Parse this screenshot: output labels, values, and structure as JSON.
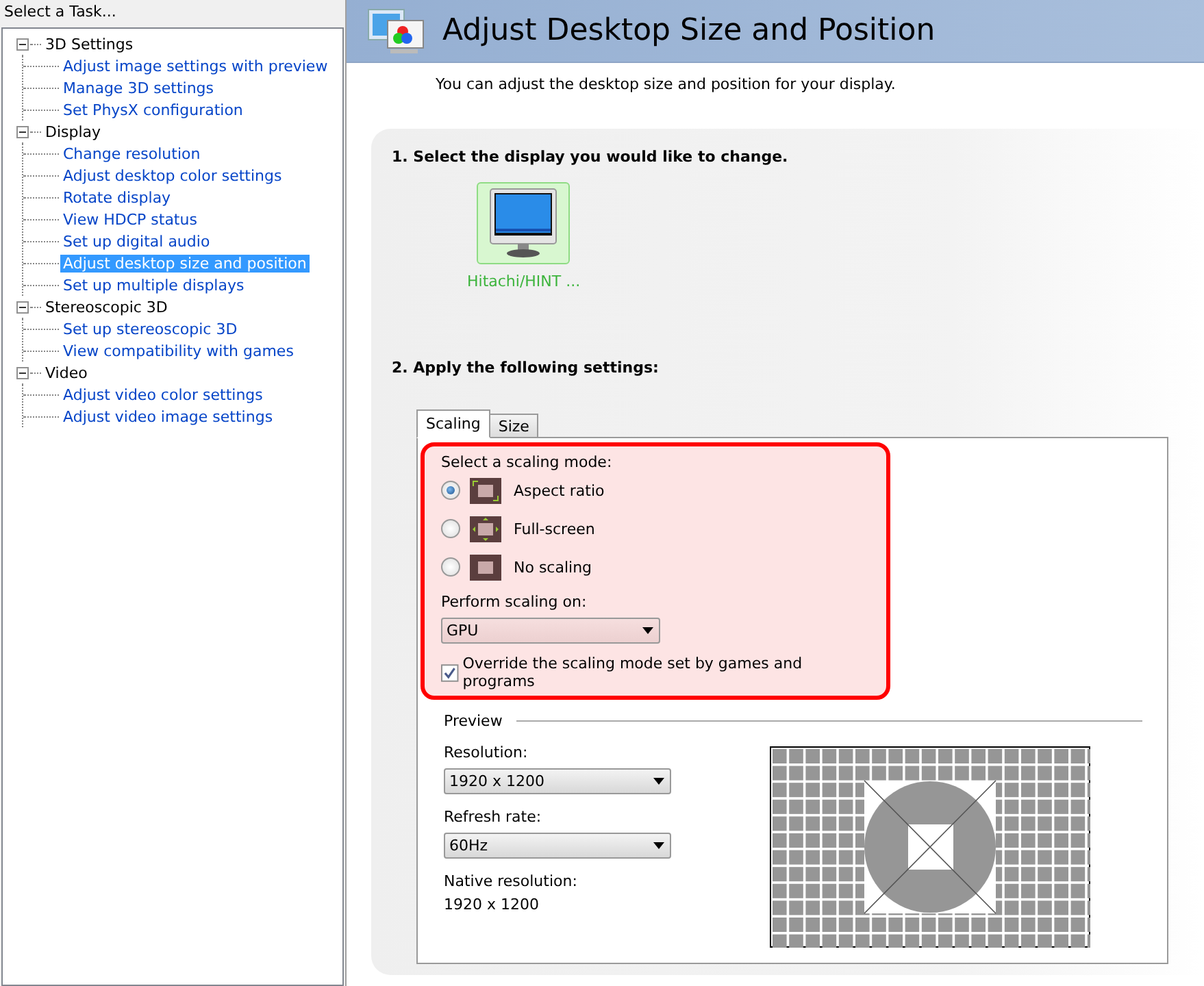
{
  "task_panel": {
    "title": "Select a Task...",
    "tree": [
      {
        "label": "3D Settings",
        "expanded": true,
        "children": [
          {
            "label": "Adjust image settings with preview",
            "selected": false
          },
          {
            "label": "Manage 3D settings",
            "selected": false
          },
          {
            "label": "Set PhysX configuration",
            "selected": false
          }
        ]
      },
      {
        "label": "Display",
        "expanded": true,
        "children": [
          {
            "label": "Change resolution",
            "selected": false
          },
          {
            "label": "Adjust desktop color settings",
            "selected": false
          },
          {
            "label": "Rotate display",
            "selected": false
          },
          {
            "label": "View HDCP status",
            "selected": false
          },
          {
            "label": "Set up digital audio",
            "selected": false
          },
          {
            "label": "Adjust desktop size and position",
            "selected": true
          },
          {
            "label": "Set up multiple displays",
            "selected": false
          }
        ]
      },
      {
        "label": "Stereoscopic 3D",
        "expanded": true,
        "children": [
          {
            "label": "Set up stereoscopic 3D",
            "selected": false
          },
          {
            "label": "View compatibility with games",
            "selected": false
          }
        ]
      },
      {
        "label": "Video",
        "expanded": true,
        "children": [
          {
            "label": "Adjust video color settings",
            "selected": false
          },
          {
            "label": "Adjust video image settings",
            "selected": false
          }
        ]
      }
    ]
  },
  "page": {
    "title": "Adjust Desktop Size and Position",
    "description": "You can adjust the desktop size and position for your display."
  },
  "step1": {
    "heading": "1. Select the display you would like to change.",
    "displays": [
      {
        "label": "Hitachi/HINT ...",
        "selected": true
      }
    ]
  },
  "step2": {
    "heading": "2. Apply the following settings:",
    "tabs": [
      {
        "label": "Scaling",
        "selected": true
      },
      {
        "label": "Size",
        "selected": false
      }
    ],
    "scaling_label": "Select a scaling mode:",
    "modes": [
      {
        "label": "Aspect ratio",
        "kind": "aspect",
        "selected": true
      },
      {
        "label": "Full-screen",
        "kind": "full",
        "selected": false
      },
      {
        "label": "No scaling",
        "kind": "none",
        "selected": false
      }
    ],
    "perform_label": "Perform scaling on:",
    "perform_value": "GPU",
    "override": {
      "label": "Override the scaling mode set by games and programs",
      "checked": true
    },
    "preview": {
      "title": "Preview",
      "resolution_label": "Resolution:",
      "resolution_value": "1920 x 1200",
      "refresh_label": "Refresh rate:",
      "refresh_value": "60Hz",
      "native_label": "Native resolution:",
      "native_value": "1920 x 1200"
    }
  }
}
